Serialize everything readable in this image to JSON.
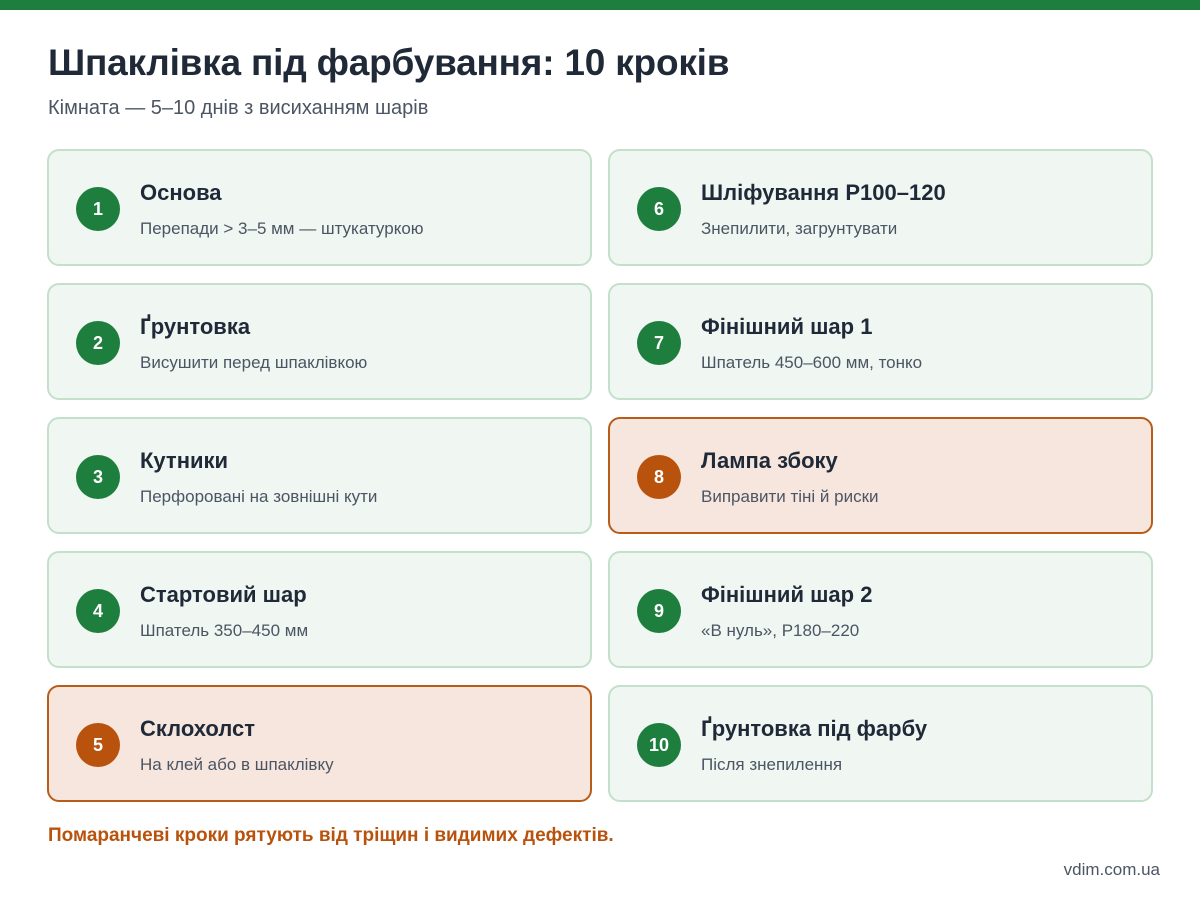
{
  "colors": {
    "accent": "#1e7e3e",
    "warning": "#b8520c",
    "card_bg": "#f0f6f1",
    "card_border": "#c3e0cb",
    "warn_bg": "#f6e6de",
    "warn_border": "#b85c1a"
  },
  "header": {
    "title": "Шпаклівка під фарбування: 10 кроків",
    "subtitle": "Кімната — 5–10 днів з висиханням шарів"
  },
  "steps": [
    {
      "number": "1",
      "title": "Основа",
      "description": "Перепади > 3–5 мм — штукатуркою",
      "highlight": false
    },
    {
      "number": "2",
      "title": "Ґрунтовка",
      "description": "Висушити перед шпаклівкою",
      "highlight": false
    },
    {
      "number": "3",
      "title": "Кутники",
      "description": "Перфоровані на зовнішні кути",
      "highlight": false
    },
    {
      "number": "4",
      "title": "Стартовий шар",
      "description": "Шпатель 350–450 мм",
      "highlight": false
    },
    {
      "number": "5",
      "title": "Склохолст",
      "description": "На клей або в шпаклівку",
      "highlight": true
    },
    {
      "number": "6",
      "title": "Шліфування Р100–120",
      "description": "Знепилити, загрунтувати",
      "highlight": false
    },
    {
      "number": "7",
      "title": "Фінішний шар 1",
      "description": "Шпатель 450–600 мм, тонко",
      "highlight": false
    },
    {
      "number": "8",
      "title": "Лампа збоку",
      "description": "Виправити тіні й риски",
      "highlight": true
    },
    {
      "number": "9",
      "title": "Фінішний шар 2",
      "description": "«В нуль», Р180–220",
      "highlight": false
    },
    {
      "number": "10",
      "title": "Ґрунтовка під фарбу",
      "description": "Після знепилення",
      "highlight": false
    }
  ],
  "note": "Помаранчеві кроки рятують від тріщин і видимих дефектів.",
  "footer": "vdim.com.ua"
}
